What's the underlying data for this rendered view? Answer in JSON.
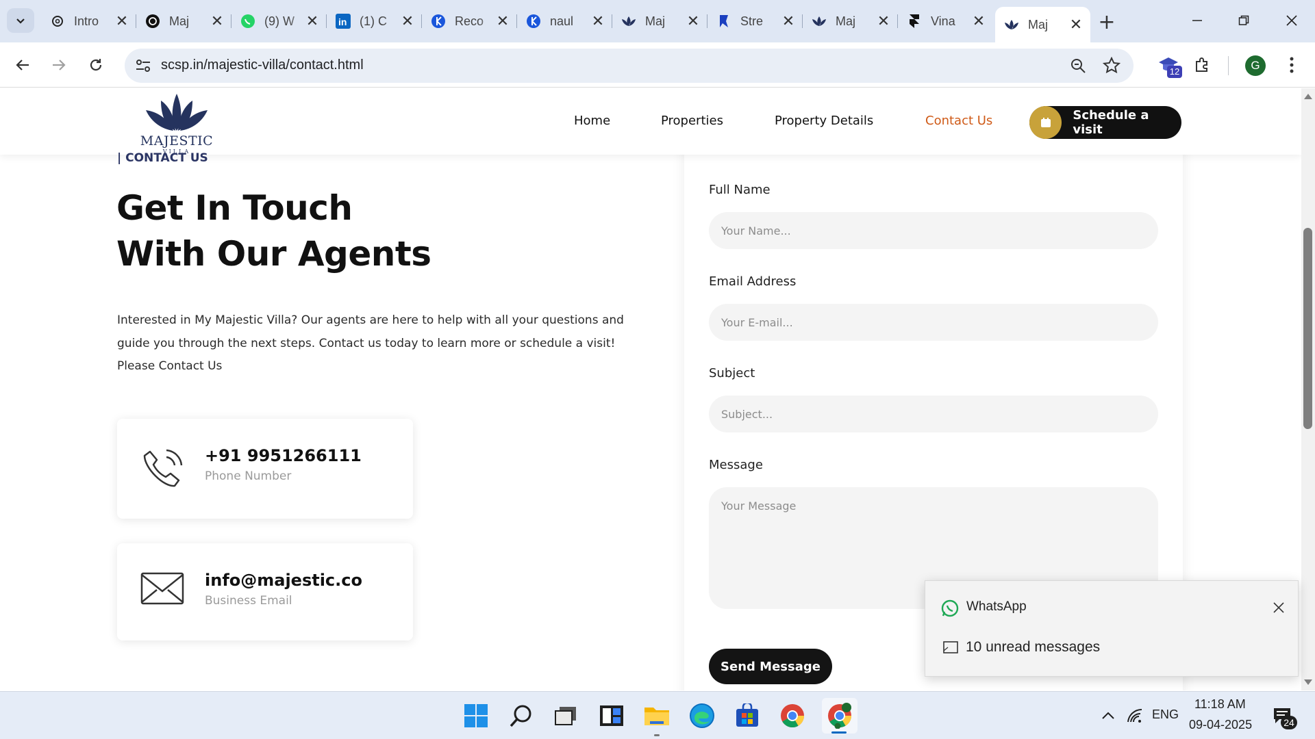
{
  "browser": {
    "tabs": [
      {
        "title": "Intro",
        "icon": "chatgpt-icon"
      },
      {
        "title": "Maj",
        "icon": "chatgpt-icon"
      },
      {
        "title": "(9) W",
        "icon": "whatsapp-icon"
      },
      {
        "title": "(1) C",
        "icon": "linkedin-icon"
      },
      {
        "title": "Reco",
        "icon": "k-icon"
      },
      {
        "title": "naul",
        "icon": "k-icon"
      },
      {
        "title": "Maj",
        "icon": "lotus-icon"
      },
      {
        "title": "Stre",
        "icon": "bookmark-icon"
      },
      {
        "title": "Maj",
        "icon": "lotus-icon"
      },
      {
        "title": "Vina",
        "icon": "framer-icon"
      },
      {
        "title": "Maj",
        "icon": "lotus-icon",
        "active": true
      }
    ],
    "url": "scsp.in/majestic-villa/contact.html",
    "extension_badge": "12",
    "profile_initial": "G"
  },
  "site": {
    "logo": {
      "word": "MAJESTIC",
      "sub": "VILLA"
    },
    "nav": [
      "Home",
      "Properties",
      "Property Details",
      "Contact Us"
    ],
    "cta": "Schedule a visit",
    "accent_color": "#cf5a17",
    "gold_color": "#c8a23a"
  },
  "contact": {
    "eyebrow": "| CONTACT US",
    "headline_line1": "Get In Touch",
    "headline_line2": "With Our Agents",
    "intro_line1": "Interested in My Majestic Villa? Our agents are here to help with all your questions and",
    "intro_line2": "guide you through the next steps. Contact us today to learn more or schedule a visit!",
    "intro_line3": "Please Contact Us",
    "phone": {
      "value": "+91 9951266111",
      "caption": "Phone Number"
    },
    "email": {
      "value": "info@majestic.co",
      "caption": "Business Email"
    }
  },
  "form": {
    "name_label": "Full Name",
    "name_placeholder": "Your Name...",
    "email_label": "Email Address",
    "email_placeholder": "Your E-mail...",
    "subject_label": "Subject",
    "subject_placeholder": "Subject...",
    "message_label": "Message",
    "message_placeholder": "Your Message",
    "submit": "Send Message"
  },
  "toast": {
    "app": "WhatsApp",
    "message": "10 unread messages"
  },
  "taskbar": {
    "language": "ENG",
    "time": "11:18 AM",
    "date": "09-04-2025",
    "notification_count": "24"
  }
}
